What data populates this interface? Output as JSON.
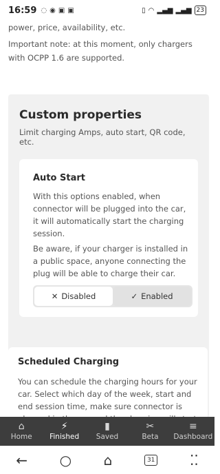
{
  "status_bar": {
    "time": "16:59",
    "battery": "23"
  },
  "intro": {
    "line1": "power, price, availability, etc.",
    "line2": "Important note: at this moment, only chargers with OCPP 1.6 are supported."
  },
  "custom_properties": {
    "title": "Custom properties",
    "subtitle": "Limit charging Amps, auto start, QR code, etc."
  },
  "auto_start": {
    "title": "Auto Start",
    "p1": "With this options enabled, when connector will be plugged into the car, it will automatically start the charging session.",
    "p2": "Be aware, if your charger is installed in a public space, anyone connecting the plug will be able to charge their car.",
    "toggle": {
      "off_label": "Disabled",
      "on_label": "Enabled",
      "selected": "Enabled"
    }
  },
  "scheduled": {
    "title": "Scheduled Charging",
    "p1": "You can schedule the charging hours for your car. Select which day of the week, start and end session time, make sure connector is plugged in the car and the charging will start as per your schedule."
  },
  "bottom_nav": {
    "items": [
      {
        "label": "Home",
        "icon": "home-icon"
      },
      {
        "label": "Finished",
        "icon": "bolt-icon"
      },
      {
        "label": "Saved",
        "icon": "bookmark-icon"
      },
      {
        "label": "Beta",
        "icon": "tools-icon"
      },
      {
        "label": "Dashboard",
        "icon": "menu-icon"
      }
    ],
    "active": "Finished"
  },
  "system_nav": {
    "calendar_day": "31"
  }
}
